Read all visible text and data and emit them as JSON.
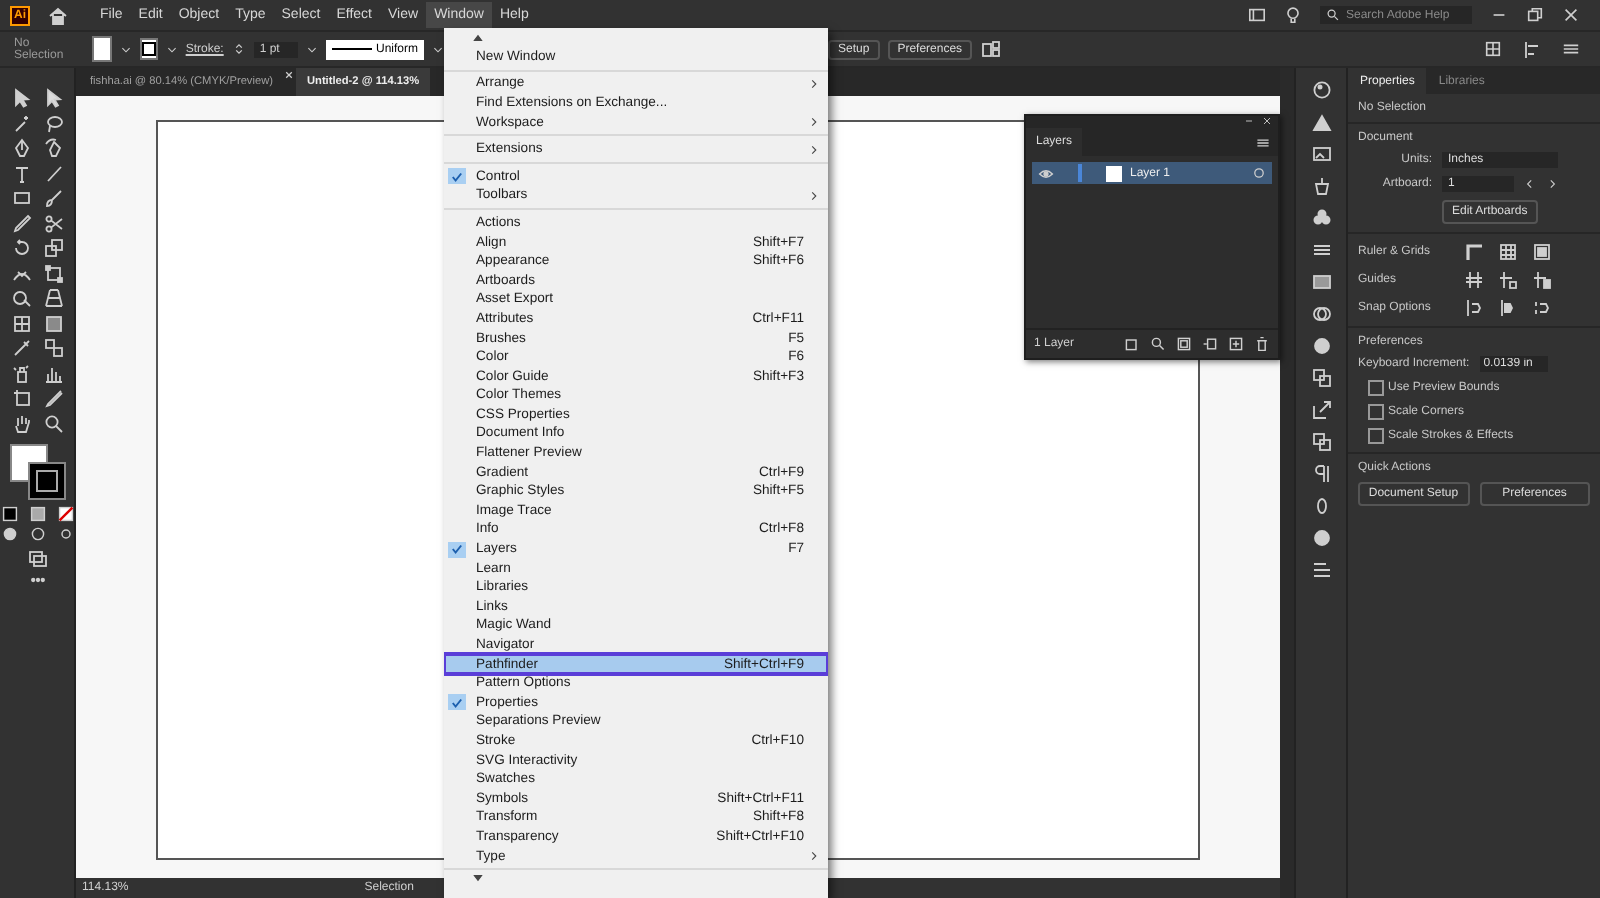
{
  "app": {
    "logo": "Ai"
  },
  "menubar": [
    {
      "label": "File",
      "selected": false
    },
    {
      "label": "Edit",
      "selected": false
    },
    {
      "label": "Object",
      "selected": false
    },
    {
      "label": "Type",
      "selected": false
    },
    {
      "label": "Select",
      "selected": false
    },
    {
      "label": "Effect",
      "selected": false
    },
    {
      "label": "View",
      "selected": false
    },
    {
      "label": "Window",
      "selected": true
    },
    {
      "label": "Help",
      "selected": false
    }
  ],
  "search": {
    "placeholder": "Search Adobe Help"
  },
  "control_bar": {
    "selection": "No Selection",
    "stroke_label": "Stroke:",
    "stroke_weight": "1 pt",
    "stroke_profile": "Uniform",
    "buttons": [
      "Setup",
      "Preferences"
    ]
  },
  "document_tabs": [
    {
      "title": "fishha.ai @ 80.14% (CMYK/Preview)",
      "selected": false
    },
    {
      "title": "Untitled-2 @ 114.13%",
      "selected": true
    }
  ],
  "window_menu": {
    "groups": [
      {
        "items": [
          {
            "label": "New Window",
            "checked": false,
            "selected": false,
            "submenu": false
          }
        ]
      },
      {
        "items": [
          {
            "label": "Arrange",
            "checked": false,
            "selected": false,
            "submenu": true
          },
          {
            "label": "Find Extensions on Exchange...",
            "checked": false,
            "selected": false,
            "submenu": false
          },
          {
            "label": "Workspace",
            "checked": false,
            "selected": false,
            "submenu": true
          }
        ]
      },
      {
        "items": [
          {
            "label": "Extensions",
            "checked": false,
            "selected": false,
            "submenu": true
          }
        ]
      },
      {
        "items": [
          {
            "label": "Control",
            "checked": true,
            "selected": false,
            "submenu": false
          },
          {
            "label": "Toolbars",
            "checked": false,
            "selected": false,
            "submenu": true
          }
        ]
      },
      {
        "items": [
          {
            "label": "Actions",
            "checked": false,
            "selected": false,
            "submenu": false
          },
          {
            "label": "Align",
            "shortcut": "Shift+F7",
            "checked": false,
            "selected": false,
            "submenu": false
          },
          {
            "label": "Appearance",
            "shortcut": "Shift+F6",
            "checked": false,
            "selected": false,
            "submenu": false
          },
          {
            "label": "Artboards",
            "checked": false,
            "selected": false,
            "submenu": false
          },
          {
            "label": "Asset Export",
            "checked": false,
            "selected": false,
            "submenu": false
          },
          {
            "label": "Attributes",
            "shortcut": "Ctrl+F11",
            "checked": false,
            "selected": false,
            "submenu": false
          },
          {
            "label": "Brushes",
            "shortcut": "F5",
            "checked": false,
            "selected": false,
            "submenu": false
          },
          {
            "label": "Color",
            "shortcut": "F6",
            "checked": false,
            "selected": false,
            "submenu": false
          },
          {
            "label": "Color Guide",
            "shortcut": "Shift+F3",
            "checked": false,
            "selected": false,
            "submenu": false
          },
          {
            "label": "Color Themes",
            "checked": false,
            "selected": false,
            "submenu": false
          },
          {
            "label": "CSS Properties",
            "checked": false,
            "selected": false,
            "submenu": false
          },
          {
            "label": "Document Info",
            "checked": false,
            "selected": false,
            "submenu": false
          },
          {
            "label": "Flattener Preview",
            "checked": false,
            "selected": false,
            "submenu": false
          },
          {
            "label": "Gradient",
            "shortcut": "Ctrl+F9",
            "checked": false,
            "selected": false,
            "submenu": false
          },
          {
            "label": "Graphic Styles",
            "shortcut": "Shift+F5",
            "checked": false,
            "selected": false,
            "submenu": false
          },
          {
            "label": "Image Trace",
            "checked": false,
            "selected": false,
            "submenu": false
          },
          {
            "label": "Info",
            "shortcut": "Ctrl+F8",
            "checked": false,
            "selected": false,
            "submenu": false
          },
          {
            "label": "Layers",
            "shortcut": "F7",
            "checked": true,
            "selected": false,
            "submenu": false
          },
          {
            "label": "Learn",
            "checked": false,
            "selected": false,
            "submenu": false
          },
          {
            "label": "Libraries",
            "checked": false,
            "selected": false,
            "submenu": false
          },
          {
            "label": "Links",
            "checked": false,
            "selected": false,
            "submenu": false
          },
          {
            "label": "Magic Wand",
            "checked": false,
            "selected": false,
            "submenu": false
          },
          {
            "label": "Navigator",
            "checked": false,
            "selected": false,
            "submenu": false
          },
          {
            "label": "Pathfinder",
            "shortcut": "Shift+Ctrl+F9",
            "checked": false,
            "selected": true,
            "submenu": false
          },
          {
            "label": "Pattern Options",
            "checked": false,
            "selected": false,
            "submenu": false
          },
          {
            "label": "Properties",
            "checked": true,
            "selected": false,
            "submenu": false
          },
          {
            "label": "Separations Preview",
            "checked": false,
            "selected": false,
            "submenu": false
          },
          {
            "label": "Stroke",
            "shortcut": "Ctrl+F10",
            "checked": false,
            "selected": false,
            "submenu": false
          },
          {
            "label": "SVG Interactivity",
            "checked": false,
            "selected": false,
            "submenu": false
          },
          {
            "label": "Swatches",
            "checked": false,
            "selected": false,
            "submenu": false
          },
          {
            "label": "Symbols",
            "shortcut": "Shift+Ctrl+F11",
            "checked": false,
            "selected": false,
            "submenu": false
          },
          {
            "label": "Transform",
            "shortcut": "Shift+F8",
            "checked": false,
            "selected": false,
            "submenu": false
          },
          {
            "label": "Transparency",
            "shortcut": "Shift+Ctrl+F10",
            "checked": false,
            "selected": false,
            "submenu": false
          },
          {
            "label": "Type",
            "checked": false,
            "selected": false,
            "submenu": true
          }
        ]
      }
    ]
  },
  "layers_panel": {
    "title": "Layers",
    "layers": [
      {
        "name": "Layer 1",
        "visible": true
      }
    ],
    "footer": "1 Layer"
  },
  "properties_panel": {
    "tabs": [
      {
        "label": "Properties",
        "selected": true
      },
      {
        "label": "Libraries",
        "selected": false
      }
    ],
    "selection": "No Selection",
    "document_heading": "Document",
    "units_label": "Units:",
    "units": "Inches",
    "artboard_label": "Artboard:",
    "artboard": "1",
    "edit_artboards": "Edit Artboards",
    "ruler_grids": "Ruler & Grids",
    "guides": "Guides",
    "snap_options": "Snap Options",
    "preferences_heading": "Preferences",
    "keyboard_increment_label": "Keyboard Increment:",
    "keyboard_increment": "0.0139 in",
    "checkboxes": [
      {
        "label": "Use Preview Bounds",
        "checked": false
      },
      {
        "label": "Scale Corners",
        "checked": false
      },
      {
        "label": "Scale Strokes & Effects",
        "checked": false
      }
    ],
    "quick_actions_heading": "Quick Actions",
    "quick_actions": [
      "Document Setup",
      "Preferences"
    ]
  },
  "status_bar": {
    "zoom": "114.13%",
    "tool": "Selection"
  }
}
